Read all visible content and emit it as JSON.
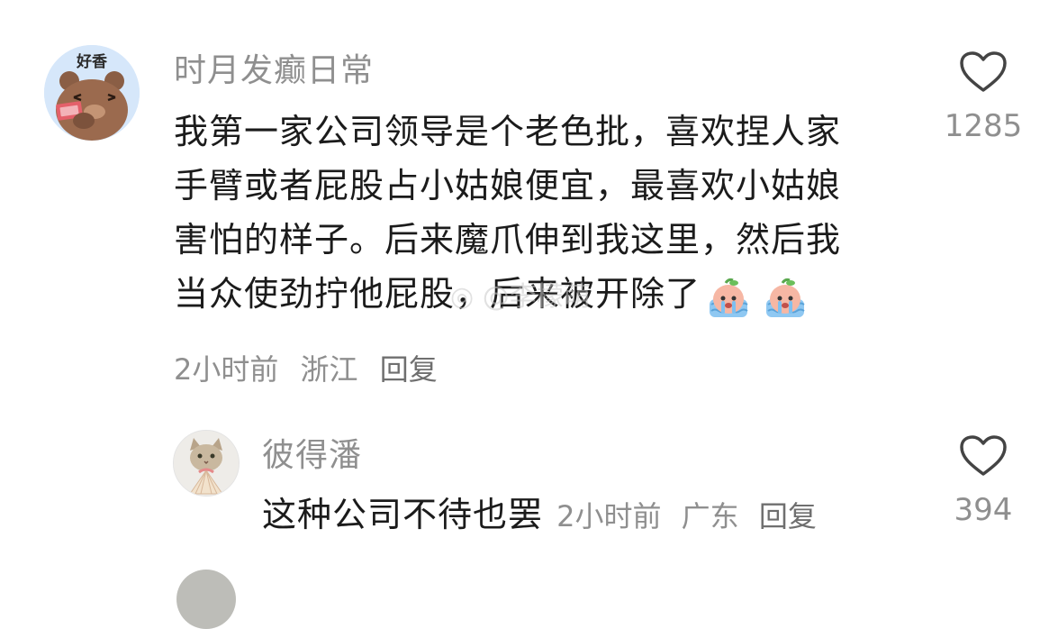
{
  "main_comment": {
    "avatar_label": "好香",
    "username": "时月发癫日常",
    "text_lines": [
      "我第一家公司领导是个老色批，喜欢捏人家",
      "手臂或者屁股占小姑娘便宜，最喜欢小姑娘",
      "害怕的样子。后来魔爪伸到我这里，然后我",
      "当众使劲拧他屁股，后来被开除了"
    ],
    "emoji": "crying-peach-emoji",
    "time": "2小时前",
    "location": "浙江",
    "reply_label": "回复",
    "like_icon": "heart-outline-icon",
    "like_count": "1285"
  },
  "watermark": "@李檬萌",
  "reply_comment": {
    "username": "彼得潘",
    "text": "这种公司不待也罢",
    "time": "2小时前",
    "location": "广东",
    "reply_label": "回复",
    "like_icon": "heart-outline-icon",
    "like_count": "394"
  },
  "colors": {
    "meta_gray": "#8f8f8f",
    "text": "#1b1b1b",
    "avatar_bg": "#d6e7fa"
  }
}
